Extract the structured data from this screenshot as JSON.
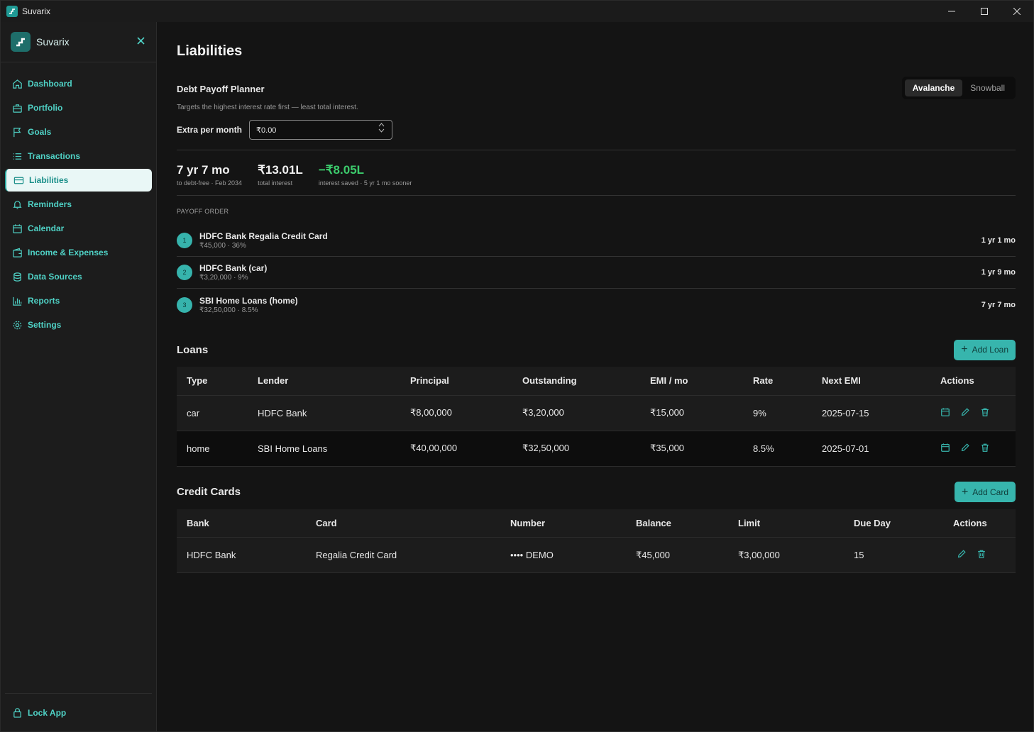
{
  "window": {
    "title": "Suvarix"
  },
  "sidebar": {
    "brand": "Suvarix",
    "items": [
      {
        "label": "Dashboard",
        "icon": "home-icon"
      },
      {
        "label": "Portfolio",
        "icon": "briefcase-icon"
      },
      {
        "label": "Goals",
        "icon": "flag-icon"
      },
      {
        "label": "Transactions",
        "icon": "list-icon"
      },
      {
        "label": "Liabilities",
        "icon": "credit-card-icon",
        "active": true
      },
      {
        "label": "Reminders",
        "icon": "bell-icon"
      },
      {
        "label": "Calendar",
        "icon": "calendar-icon"
      },
      {
        "label": "Income & Expenses",
        "icon": "wallet-icon"
      },
      {
        "label": "Data Sources",
        "icon": "database-icon"
      },
      {
        "label": "Reports",
        "icon": "bar-chart-icon"
      },
      {
        "label": "Settings",
        "icon": "gear-icon"
      }
    ],
    "lock_label": "Lock App"
  },
  "page": {
    "title": "Liabilities"
  },
  "planner": {
    "title": "Debt Payoff Planner",
    "strategies": [
      "Avalanche",
      "Snowball"
    ],
    "selected_strategy": "Avalanche",
    "description": "Targets the highest interest rate first — least total interest.",
    "extra_label": "Extra per month",
    "extra_value": "₹0.00",
    "stats": [
      {
        "value": "7 yr 7 mo",
        "caption": "to debt-free · Feb 2034"
      },
      {
        "value": "₹13.01L",
        "caption": "total interest"
      },
      {
        "value": "−₹8.05L",
        "caption": "interest saved · 5 yr 1 mo sooner"
      }
    ],
    "order_label": "PAYOFF ORDER",
    "order": [
      {
        "num": "1",
        "name": "HDFC Bank Regalia Credit Card",
        "sub": "₹45,000 · 36%",
        "time": "1 yr 1 mo"
      },
      {
        "num": "2",
        "name": "HDFC Bank (car)",
        "sub": "₹3,20,000 · 9%",
        "time": "1 yr 9 mo"
      },
      {
        "num": "3",
        "name": "SBI Home Loans (home)",
        "sub": "₹32,50,000 · 8.5%",
        "time": "7 yr 7 mo"
      }
    ]
  },
  "loans": {
    "title": "Loans",
    "add_label": "Add Loan",
    "columns": [
      "Type",
      "Lender",
      "Principal",
      "Outstanding",
      "EMI / mo",
      "Rate",
      "Next EMI",
      "Actions"
    ],
    "rows": [
      [
        "car",
        "HDFC Bank",
        "₹8,00,000",
        "₹3,20,000",
        "₹15,000",
        "9%",
        "2025-07-15"
      ],
      [
        "home",
        "SBI Home Loans",
        "₹40,00,000",
        "₹32,50,000",
        "₹35,000",
        "8.5%",
        "2025-07-01"
      ]
    ]
  },
  "cards": {
    "title": "Credit Cards",
    "add_label": "Add Card",
    "columns": [
      "Bank",
      "Card",
      "Number",
      "Balance",
      "Limit",
      "Due Day",
      "Actions"
    ],
    "rows": [
      [
        "HDFC Bank",
        "Regalia Credit Card",
        "•••• DEMO",
        "₹45,000",
        "₹3,00,000",
        "15"
      ]
    ]
  },
  "colors": {
    "accent": "#37b5ad",
    "positive": "#3ccb6c",
    "background": "#141414"
  }
}
